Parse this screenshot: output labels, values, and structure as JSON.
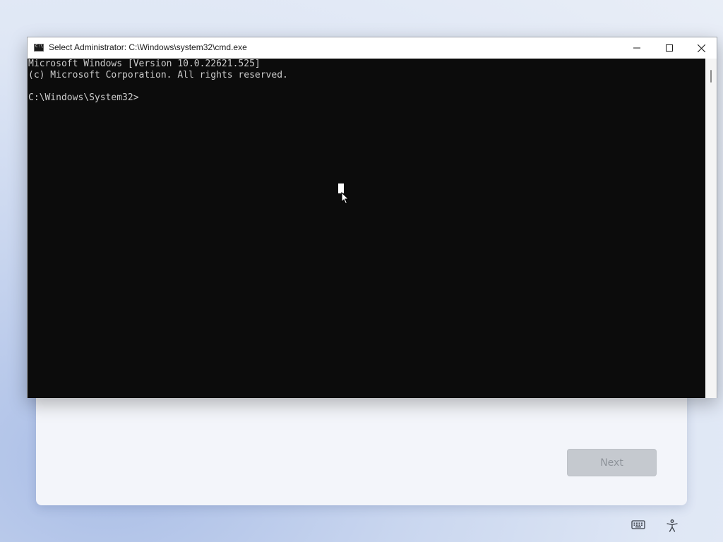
{
  "oobe": {
    "next_label": "Next"
  },
  "window": {
    "title": "Select Administrator: C:\\Windows\\system32\\cmd.exe",
    "icon": "cmd-icon"
  },
  "console": {
    "lines": [
      "Microsoft Windows [Version 10.0.22621.525]",
      "(c) Microsoft Corporation. All rights reserved.",
      "",
      "C:\\Windows\\System32>"
    ],
    "background": "#0c0c0c",
    "foreground": "#cccccc"
  },
  "tray": {
    "icons": [
      "keyboard-icon",
      "accessibility-icon"
    ]
  }
}
